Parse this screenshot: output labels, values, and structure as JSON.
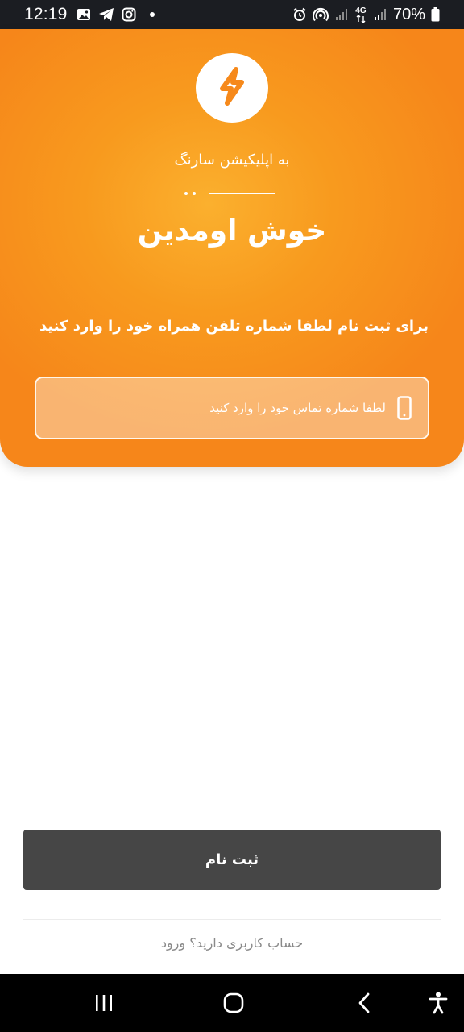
{
  "status_bar": {
    "time": "12:19",
    "battery": "70%",
    "network": "4G"
  },
  "header": {
    "subtitle": "به اپلیکیشن سارنگ",
    "title": "خوش اومدین",
    "description": "برای ثبت نام لطفا شماره تلفن همراه خود را وارد کنید",
    "accent_color": "#f89a1e"
  },
  "phone_field": {
    "placeholder": "لطفا شماره تماس خود را وارد کنید",
    "value": ""
  },
  "actions": {
    "register_label": "ثبت نام",
    "login_prompt": "حساب کاربری دارید؟",
    "login_label": "ورود"
  },
  "icons": {
    "logo": "lightning-bolt-icon",
    "phone": "smartphone-icon",
    "nav_recents": "recent-apps-icon",
    "nav_home": "home-icon",
    "nav_back": "back-icon",
    "nav_accessibility": "accessibility-icon"
  }
}
